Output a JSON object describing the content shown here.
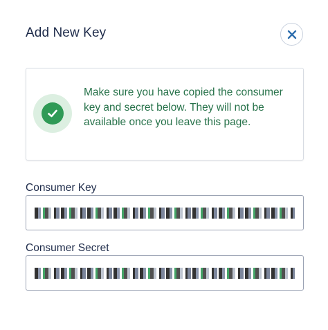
{
  "modal": {
    "title": "Add New Key",
    "close_icon": "close-icon"
  },
  "notice": {
    "icon": "check-circle-icon",
    "message": "Make sure you have copied the consumer key and secret below. They will not be available once you leave this page.",
    "colors": {
      "text": "#27724a",
      "icon": "#2f9a56",
      "icon_bg": "#dcefe1"
    }
  },
  "fields": {
    "consumer_key": {
      "label": "Consumer Key",
      "value": ""
    },
    "consumer_secret": {
      "label": "Consumer Secret",
      "value": ""
    }
  },
  "colors": {
    "accent": "#2f6fae",
    "title": "#1e2b4a"
  }
}
